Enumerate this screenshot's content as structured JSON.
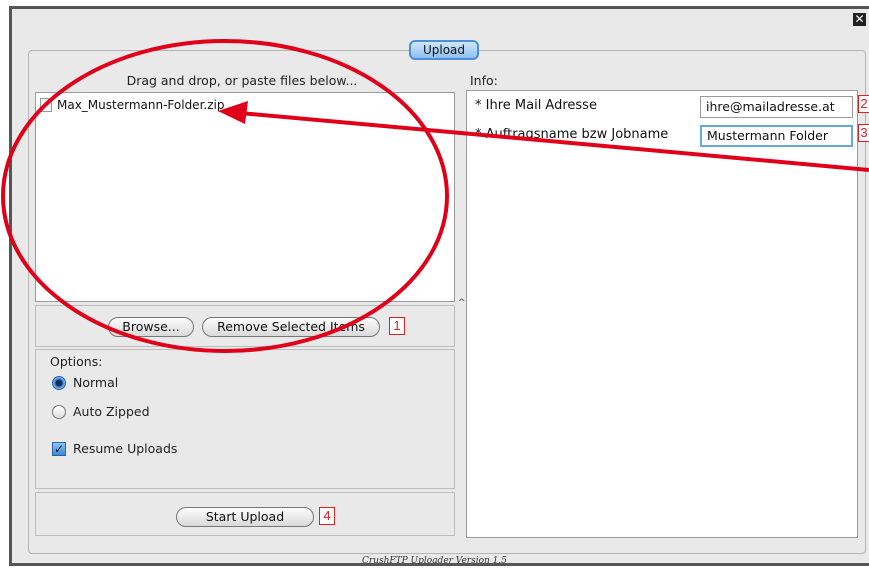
{
  "window": {
    "close_icon": "close-icon"
  },
  "tabs": {
    "upload_label": "Upload"
  },
  "left": {
    "drop_header": "Drag and drop, or paste files below...",
    "files": [
      {
        "name": "Max_Mustermann-Folder.zip",
        "icon": "file-icon"
      }
    ],
    "browse_label": "Browse...",
    "remove_label": "Remove Selected Items",
    "marker_1": "1",
    "options_title": "Options:",
    "option_normal": "Normal",
    "option_auto_zipped": "Auto Zipped",
    "selected_option": "Normal",
    "resume_label": "Resume Uploads",
    "resume_checked": true,
    "start_label": "Start Upload",
    "marker_4": "4"
  },
  "right": {
    "info_header": "Info:",
    "mail_label": "* Ihre Mail Adresse",
    "mail_value": "ihre@mailadresse.at",
    "marker_2": "2",
    "job_label": "* Auftragsname bzw Jobname",
    "job_value": "Mustermann Folder",
    "marker_3": "3"
  },
  "footer": {
    "version_text": "CrushFTP Uploader Version 1.5"
  },
  "colors": {
    "annotation_red": "#e0001a",
    "accent_blue": "#4a90d9"
  }
}
